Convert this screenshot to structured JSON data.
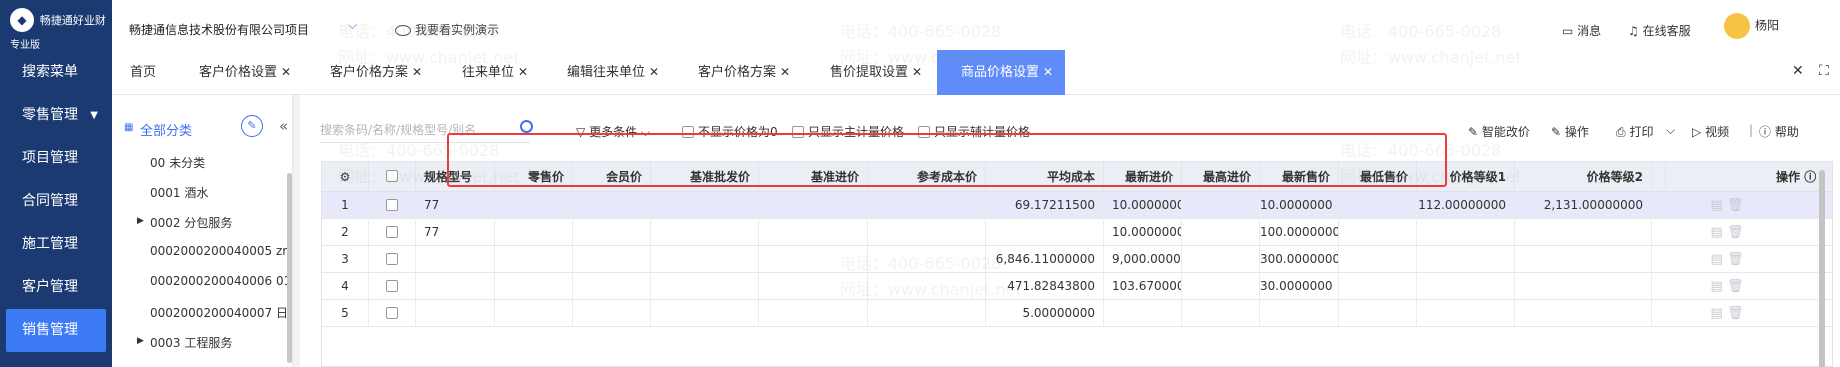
{
  "brand": {
    "name": "畅捷通好业财",
    "edition": "专业版"
  },
  "sidebar": {
    "items": [
      {
        "label": "搜索菜单"
      },
      {
        "label": "零售管理",
        "arrow": "▼"
      },
      {
        "label": "项目管理"
      },
      {
        "label": "合同管理"
      },
      {
        "label": "施工管理"
      },
      {
        "label": "客户管理"
      },
      {
        "label": "销售管理",
        "active": true
      }
    ]
  },
  "topbar": {
    "company": "畅捷通信息技术股份有限公司项目",
    "demo": "我要看实例演示",
    "messages": "消息",
    "service": "在线客服",
    "user": "杨阳"
  },
  "tabs": [
    {
      "label": "首页"
    },
    {
      "label": "客户价格设置"
    },
    {
      "label": "客户价格方案"
    },
    {
      "label": "往来单位"
    },
    {
      "label": "编辑往来单位"
    },
    {
      "label": "客户价格方案"
    },
    {
      "label": "售价提取设置"
    },
    {
      "label": "商品价格设置",
      "active": true
    }
  ],
  "tree": {
    "header": "全部分类",
    "nodes": [
      {
        "label": "00 未分类"
      },
      {
        "label": "0001 酒水"
      },
      {
        "label": "0002 分包服务"
      },
      {
        "label": "0002000200040005 zr"
      },
      {
        "label": "0002000200040006 01"
      },
      {
        "label": "0002000200040007 日"
      },
      {
        "label": "0003 工程服务"
      }
    ]
  },
  "toolbar": {
    "search_placeholder": "搜索条码/名称/规格型号/别名",
    "more": "更多条件",
    "opt1": "不显示价格为0",
    "opt2": "只显示主计量价格",
    "opt3": "只显示辅计量价格",
    "smart": "智能改价",
    "op": "操作",
    "print": "打印",
    "video": "视频",
    "help": "帮助"
  },
  "table": {
    "headers": [
      "规格型号",
      "零售价",
      "会员价",
      "基准批发价",
      "基准进价",
      "参考成本价",
      "平均成本",
      "最新进价",
      "最高进价",
      "最新售价",
      "最低售价",
      "价格等级1",
      "价格等级2",
      "操作"
    ],
    "rows": [
      {
        "no": "1",
        "spec": "77",
        "retail": "",
        "member": "",
        "wholesale": "",
        "basebuy": "",
        "refcost": "",
        "avgcost": "69.17211500",
        "lastbuy": "10.0000000",
        "maxbuy": "",
        "lastsale": "10.0000000",
        "minsale": "",
        "lvl1": "112.00000000",
        "lvl2": "2,131.00000000"
      },
      {
        "no": "2",
        "spec": "77",
        "retail": "",
        "member": "",
        "wholesale": "",
        "basebuy": "",
        "refcost": "",
        "avgcost": "",
        "lastbuy": "10.0000000",
        "maxbuy": "",
        "lastsale": "100.0000000",
        "minsale": "",
        "lvl1": "",
        "lvl2": ""
      },
      {
        "no": "3",
        "spec": "",
        "retail": "",
        "member": "",
        "wholesale": "",
        "basebuy": "",
        "refcost": "",
        "avgcost": "6,846.11000000",
        "lastbuy": "9,000.00000",
        "maxbuy": "",
        "lastsale": "300.0000000",
        "minsale": "",
        "lvl1": "",
        "lvl2": ""
      },
      {
        "no": "4",
        "spec": "",
        "retail": "",
        "member": "",
        "wholesale": "",
        "basebuy": "",
        "refcost": "",
        "avgcost": "471.82843800",
        "lastbuy": "103.670000",
        "maxbuy": "",
        "lastsale": "30.0000000",
        "minsale": "",
        "lvl1": "",
        "lvl2": ""
      },
      {
        "no": "5",
        "spec": "",
        "retail": "",
        "member": "",
        "wholesale": "",
        "basebuy": "",
        "refcost": "",
        "avgcost": "5.00000000",
        "lastbuy": "",
        "maxbuy": "",
        "lastsale": "",
        "minsale": "",
        "lvl1": "",
        "lvl2": ""
      }
    ]
  },
  "watermark": {
    "phone": "电话：400-665-0028",
    "site": "网址：www.chanjet.net"
  },
  "colors": {
    "sidebar": "#1b3a72",
    "accent": "#3d7bf5",
    "active_tab": "#5f8cf8",
    "highlight_border": "#f0393c",
    "selected_row": "#e7e9fb"
  }
}
